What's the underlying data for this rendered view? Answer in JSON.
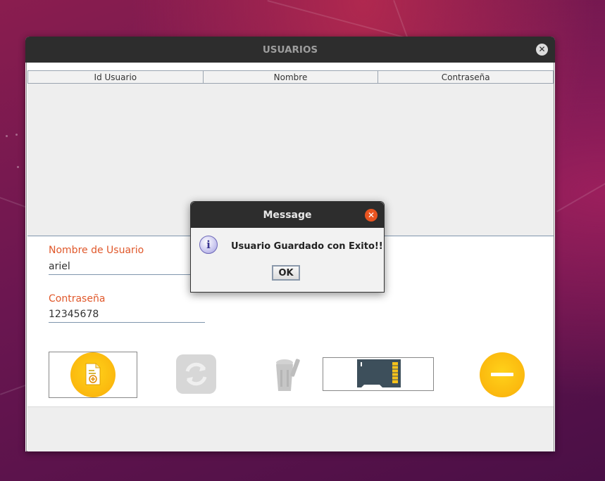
{
  "window": {
    "title": "USUARIOS",
    "close_glyph": "✕"
  },
  "table": {
    "headers": [
      "Id Usuario",
      "Nombre",
      "Contraseña"
    ],
    "rows": []
  },
  "form": {
    "username_label": "Nombre de Usuario",
    "username_value": "ariel",
    "password_label": "Contraseña",
    "password_value": "12345678"
  },
  "buttons": [
    {
      "name": "add-user-button",
      "icon": "add-document-icon",
      "state": "enabled"
    },
    {
      "name": "refresh-button",
      "icon": "refresh-icon",
      "state": "disabled"
    },
    {
      "name": "delete-button",
      "icon": "trash-icon",
      "state": "disabled"
    },
    {
      "name": "save-button",
      "icon": "memory-card-icon",
      "state": "enabled"
    },
    {
      "name": "remove-button",
      "icon": "minus-icon",
      "state": "enabled"
    }
  ],
  "dialog": {
    "title": "Message",
    "message": "Usuario Guardado con Exito!!",
    "ok_label": "OK",
    "icon": "info-icon",
    "close_glyph": "✕"
  },
  "colors": {
    "accent_orange": "#e0582b",
    "titlebar": "#2d2d2d",
    "coin_yellow": "#fbb80e",
    "dialog_close": "#e95420"
  }
}
